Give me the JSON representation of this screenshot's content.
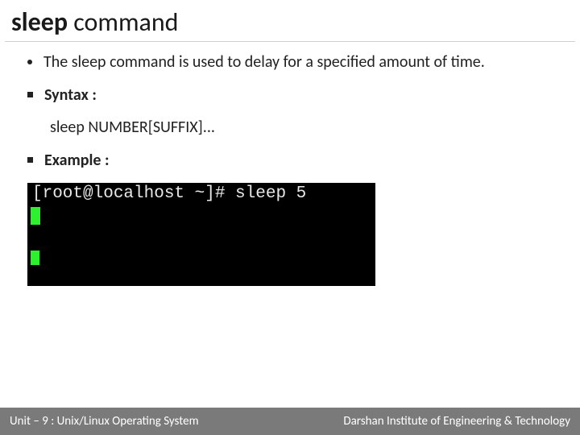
{
  "title": {
    "bold": "sleep ",
    "normal": "command"
  },
  "bullets": {
    "intro": "The sleep command is used to delay for a specified amount of time.",
    "syntax_label": "Syntax :",
    "syntax_value": "sleep NUMBER[SUFFIX]...",
    "example_label": "Example :"
  },
  "terminal": {
    "prompt": "[root@localhost ~]# sleep 5"
  },
  "footer": {
    "left": "Unit – 9  : Unix/Linux Operating System",
    "right": "Darshan Institute of Engineering & Technology"
  }
}
